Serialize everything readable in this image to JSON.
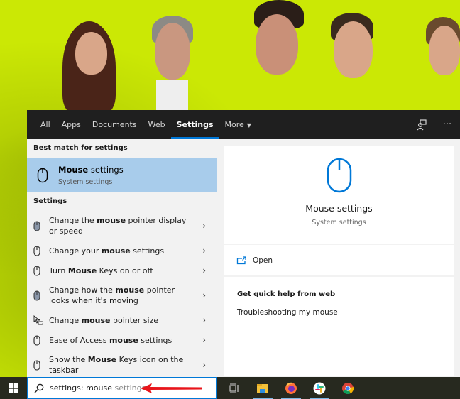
{
  "tabs": [
    {
      "label": "All",
      "active": false
    },
    {
      "label": "Apps",
      "active": false
    },
    {
      "label": "Documents",
      "active": false
    },
    {
      "label": "Web",
      "active": false
    },
    {
      "label": "Settings",
      "active": true
    },
    {
      "label": "More",
      "active": false
    }
  ],
  "tab_icons": {
    "feedback": "feedback-person-icon",
    "more_options": "ellipsis-icon",
    "more_options_glyph": "···"
  },
  "left": {
    "best_match_label": "Best match for settings",
    "best_match": {
      "title_bold": "Mouse",
      "title_rest": " settings",
      "subtitle": "System settings"
    },
    "settings_label": "Settings",
    "results": [
      {
        "icon": "mouse-filled-icon",
        "pre": "Change the ",
        "bold": "mouse",
        "post": " pointer display or speed"
      },
      {
        "icon": "mouse-outline-icon",
        "pre": "Change your ",
        "bold": "mouse",
        "post": " settings"
      },
      {
        "icon": "mouse-outline-icon",
        "pre": "Turn ",
        "bold": "Mouse",
        "post": " Keys on or off"
      },
      {
        "icon": "mouse-filled-icon",
        "pre": "Change how the ",
        "bold": "mouse",
        "post": " pointer looks when it's moving"
      },
      {
        "icon": "pointer-hand-icon",
        "pre": "Change ",
        "bold": "mouse",
        "post": " pointer size"
      },
      {
        "icon": "mouse-outline-icon",
        "pre": "Ease of Access ",
        "bold": "mouse",
        "post": " settings"
      },
      {
        "icon": "mouse-outline-icon",
        "pre": "Show the ",
        "bold": "Mouse",
        "post": " Keys icon on the taskbar"
      }
    ]
  },
  "right": {
    "title": "Mouse settings",
    "subtitle": "System settings",
    "open_label": "Open",
    "help_title": "Get quick help from web",
    "help_link": "Troubleshooting my mouse"
  },
  "taskbar": {
    "search_typed": "settings: mouse",
    "search_hint": " settings",
    "apps": [
      "task-view",
      "file-explorer",
      "firefox",
      "slack",
      "chrome"
    ]
  },
  "colors": {
    "accent": "#0078d7",
    "highlight": "#a8cceb",
    "tabbar": "#1f1f1f",
    "annotation_arrow": "#e8151b"
  }
}
